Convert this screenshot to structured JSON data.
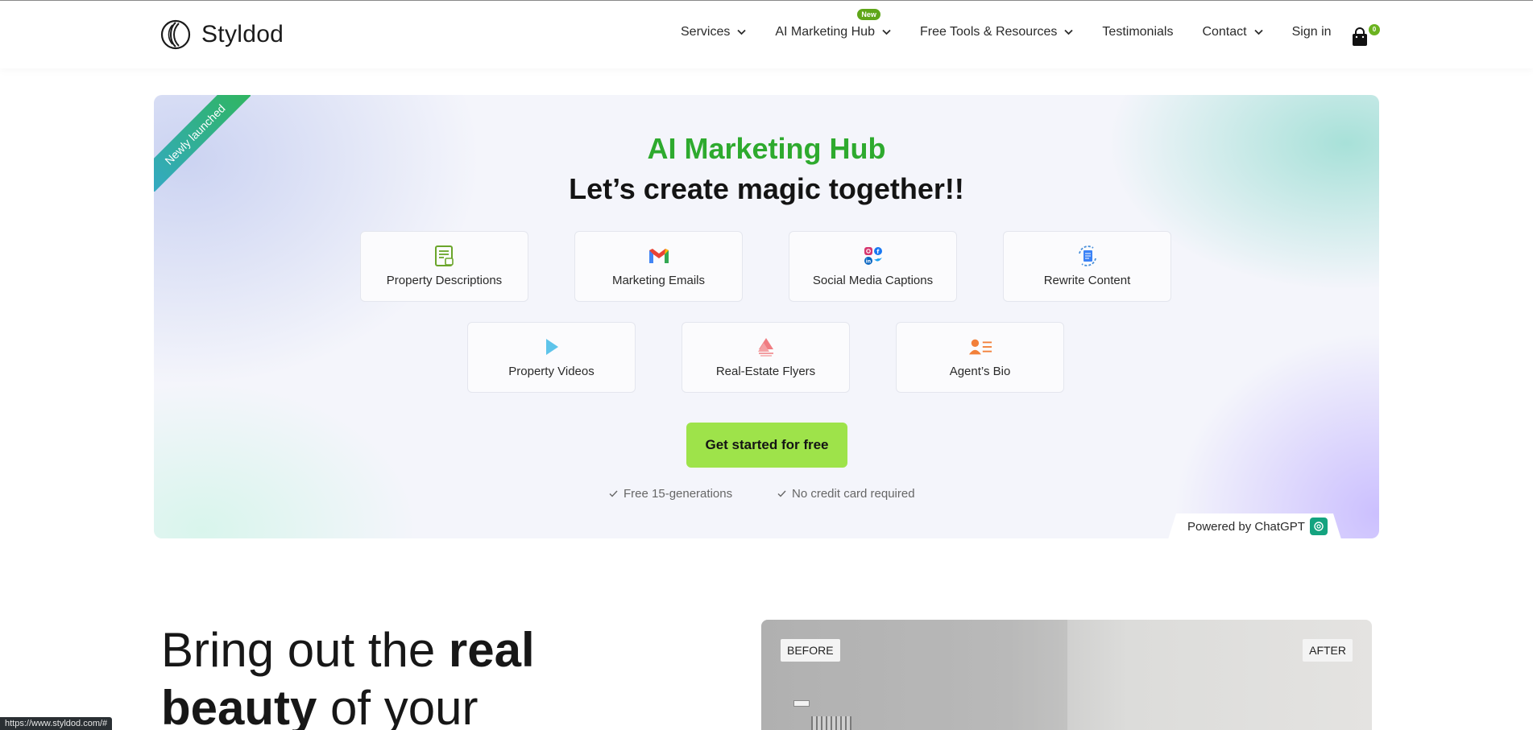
{
  "header": {
    "brand": "Styldod",
    "nav": [
      {
        "label": "Services"
      },
      {
        "label": "AI Marketing Hub",
        "badge": "New"
      },
      {
        "label": "Free Tools & Resources"
      },
      {
        "label": "Testimonials"
      },
      {
        "label": "Contact"
      },
      {
        "label": "Sign in"
      }
    ],
    "cart_count": "0"
  },
  "hero": {
    "ribbon": "Newly launched",
    "title": "AI Marketing Hub",
    "subtitle": "Let’s create magic together!!",
    "tiles": [
      {
        "label": "Property Descriptions",
        "icon": "document-icon"
      },
      {
        "label": "Marketing Emails",
        "icon": "gmail-icon"
      },
      {
        "label": "Social Media Captions",
        "icon": "social-media-icon"
      },
      {
        "label": "Rewrite Content",
        "icon": "rewrite-icon"
      },
      {
        "label": "Property Videos",
        "icon": "play-icon"
      },
      {
        "label": "Real-Estate Flyers",
        "icon": "flyer-icon"
      },
      {
        "label": "Agent’s Bio",
        "icon": "agent-bio-icon"
      }
    ],
    "cta": "Get started for free",
    "benefits": [
      "Free 15-generations",
      "No credit card required"
    ],
    "powered_by": "Powered by ChatGPT",
    "colors": {
      "title_green": "#2eaa2e",
      "cta_green": "#9ee34a"
    }
  },
  "showcase": {
    "headline_parts": [
      "Bring out the ",
      "real",
      "beauty",
      " of your"
    ],
    "before_label": "BEFORE",
    "after_label": "AFTER"
  },
  "status_url": "https://www.styldod.com/#"
}
